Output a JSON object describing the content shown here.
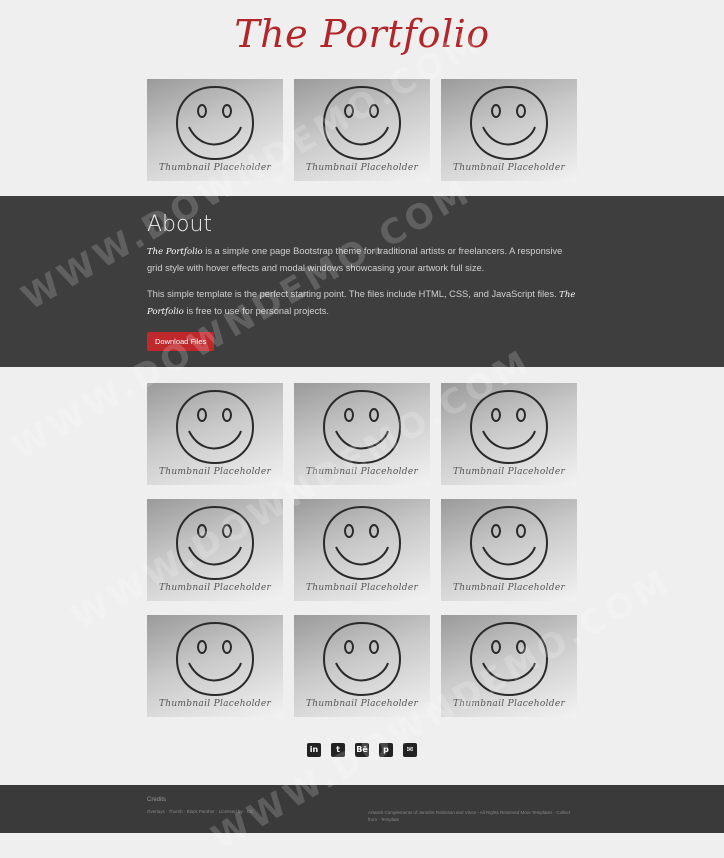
{
  "header": {
    "brand": "The Portfolio"
  },
  "thumbnail_caption": "Thumbnail Placeholder",
  "about": {
    "title": "About",
    "brand_inline": "The Portfolio",
    "p1_rest": " is a simple one page Bootstrap theme for traditional artists or freelancers. A responsive grid style with hover effects and modal windows showcasing your artwork full size.",
    "p2_text": "This simple template is the perfect starting point. The files include HTML, CSS, and JavaScript files. ",
    "p2_rest": " is free to use for personal projects.",
    "download_label": "Download Files"
  },
  "social": [
    {
      "name": "linkedin-icon",
      "glyph": "in"
    },
    {
      "name": "twitter-icon",
      "glyph": "t"
    },
    {
      "name": "behance-icon",
      "glyph": "Bē"
    },
    {
      "name": "pinterest-icon",
      "glyph": "p"
    },
    {
      "name": "email-icon",
      "glyph": "✉"
    }
  ],
  "footer": {
    "credits_heading": "Credits",
    "left_line": "Overlays · Thumb · Black Panther · Licensed by · CC",
    "right_line": "Artwork Complements of Jennifer Robinson and Vince - All Rights Reserved More Templates · Collect from · Template"
  },
  "watermark": "WWW.DOWNDEMO.COM",
  "colors": {
    "accent": "#c0292c",
    "brand": "#b2262a",
    "dark_band": "#3e3e3e",
    "footer": "#3a3a3a"
  }
}
